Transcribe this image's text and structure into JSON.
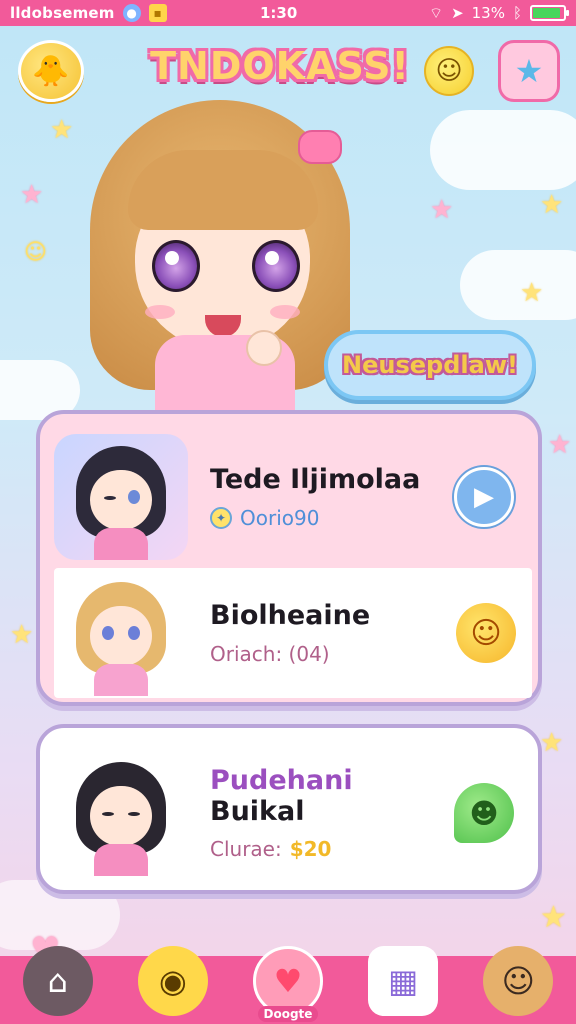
{
  "status_bar": {
    "carrier": "lldobsemem",
    "time": "1:30",
    "battery_text": "13%",
    "battery_level_percent": 90
  },
  "header": {
    "title": "TNDOKASS!",
    "mascot_icon": "chick-icon",
    "smile_icon": "smile-icon",
    "fav_icon": "star-wand-icon"
  },
  "update_button": {
    "label": "Neusepdlaw!"
  },
  "cards": [
    {
      "name": "Tede Iljimolaa",
      "sub": "Oorio90",
      "action_icon": "play-icon"
    },
    {
      "name": "Biolheaine",
      "sub": "Oriach: (04)",
      "action_icon": "smile-face-icon"
    },
    {
      "name_line1": "Pudehani",
      "name_line2": "Buikal",
      "sub_label": "Clurae:",
      "sub_value": "$20",
      "action_icon": "chat-bubble-icon"
    }
  ],
  "bottom_nav": {
    "items": [
      {
        "id": "home",
        "icon": "home-icon"
      },
      {
        "id": "mascot",
        "icon": "chick-icon"
      },
      {
        "id": "favorites",
        "icon": "heart-icon",
        "label": "Doogte"
      },
      {
        "id": "games",
        "icon": "game-icon"
      },
      {
        "id": "profile",
        "icon": "character-icon"
      }
    ]
  },
  "colors": {
    "accent_pink": "#f25a9a",
    "panel_pink": "#ffd9e6",
    "panel_border": "#b9a4d9",
    "title_yellow": "#ffd36b"
  }
}
